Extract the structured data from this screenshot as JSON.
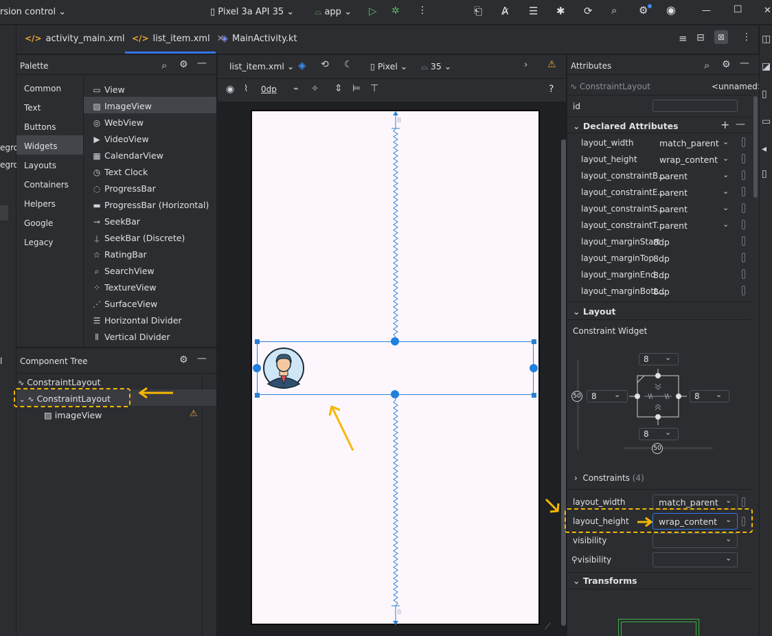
{
  "titlebar": {
    "project_menu": "rsion control",
    "device": "Pixel 3a API 35",
    "run_config": "app"
  },
  "tabs": [
    {
      "label": "activity_main.xml"
    },
    {
      "label": "list_item.xml"
    },
    {
      "label": "MainActivity.kt"
    }
  ],
  "left_stub": {
    "text1": "egrou",
    "text2": "egrou",
    "text3": "l"
  },
  "palette": {
    "title": "Palette",
    "categories": [
      "Common",
      "Text",
      "Buttons",
      "Widgets",
      "Layouts",
      "Containers",
      "Helpers",
      "Google",
      "Legacy"
    ],
    "selected_category": "Widgets",
    "widgets": [
      "View",
      "ImageView",
      "WebView",
      "VideoView",
      "CalendarView",
      "Text Clock",
      "ProgressBar",
      "ProgressBar (Horizontal)",
      "SeekBar",
      "SeekBar (Discrete)",
      "RatingBar",
      "SearchView",
      "TextureView",
      "SurfaceView",
      "Horizontal Divider",
      "Vertical Divider"
    ],
    "selected_widget": "ImageView"
  },
  "component_tree": {
    "title": "Component Tree",
    "items": [
      "ConstraintLayout",
      "ConstraintLayout",
      "imageView"
    ]
  },
  "design_toolbar": {
    "file": "list_item.xml",
    "device": "Pixel",
    "api": "35",
    "margin": "0dp",
    "help": "?"
  },
  "canvas": {
    "margin_label_top": "8",
    "margin_label_bottom": "8"
  },
  "attributes": {
    "title": "Attributes",
    "component": "ConstraintLayout",
    "component_id": "<unnamed>",
    "id_label": "id",
    "declared_title": "Declared Attributes",
    "declared": [
      {
        "name": "layout_width",
        "value": "match_parent"
      },
      {
        "name": "layout_height",
        "value": "wrap_content"
      },
      {
        "name": "layout_constraintB...",
        "value": "parent"
      },
      {
        "name": "layout_constraintE...",
        "value": "parent"
      },
      {
        "name": "layout_constraintS...",
        "value": "parent"
      },
      {
        "name": "layout_constraintT...",
        "value": "parent"
      },
      {
        "name": "layout_marginStart",
        "value": "8dp"
      },
      {
        "name": "layout_marginTop",
        "value": "8dp"
      },
      {
        "name": "layout_marginEnd",
        "value": "8dp"
      },
      {
        "name": "layout_marginBott...",
        "value": "8dp"
      }
    ],
    "layout_title": "Layout",
    "constraint_widget_label": "Constraint Widget",
    "cw_top": "8",
    "cw_left": "8",
    "cw_right": "8",
    "cw_bottom": "8",
    "bias_v": "50",
    "bias_h": "50",
    "constraints_label": "Constraints",
    "constraints_count": "(4)",
    "layout_width_label": "layout_width",
    "layout_width_value": "match_parent",
    "layout_height_label": "layout_height",
    "layout_height_value": "wrap_content",
    "visibility_label": "visibility",
    "tools_visibility_label": "visibility",
    "transforms_title": "Transforms"
  },
  "colors": {
    "accent": "#2b80d4",
    "highlight": "#f5b800",
    "warning": "#f0a732"
  }
}
